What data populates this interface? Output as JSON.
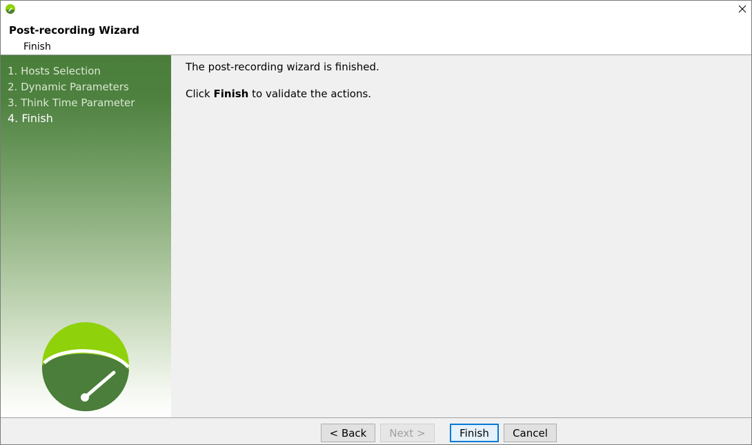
{
  "window": {
    "app_icon": "app-gauge-icon",
    "close_icon": "close-icon"
  },
  "header": {
    "title": "Post-recording Wizard",
    "subtitle": "Finish"
  },
  "sidebar": {
    "steps": [
      {
        "label": "1. Hosts Selection",
        "active": false
      },
      {
        "label": "2. Dynamic Parameters",
        "active": false
      },
      {
        "label": "3. Think Time Parameter",
        "active": false
      },
      {
        "label": "4. Finish",
        "active": true
      }
    ],
    "logo_icon": "gauge-logo-icon"
  },
  "content": {
    "line1": "The post-recording wizard is finished.",
    "line2_prefix": "Click ",
    "line2_bold": "Finish",
    "line2_suffix": " to validate the actions."
  },
  "footer": {
    "back_label": "< Back",
    "next_label": "Next >",
    "finish_label": "Finish",
    "cancel_label": "Cancel"
  },
  "colors": {
    "brand_green": "#4a7e3a",
    "brand_lime": "#8fd10a",
    "focus_blue": "#0078d7"
  }
}
